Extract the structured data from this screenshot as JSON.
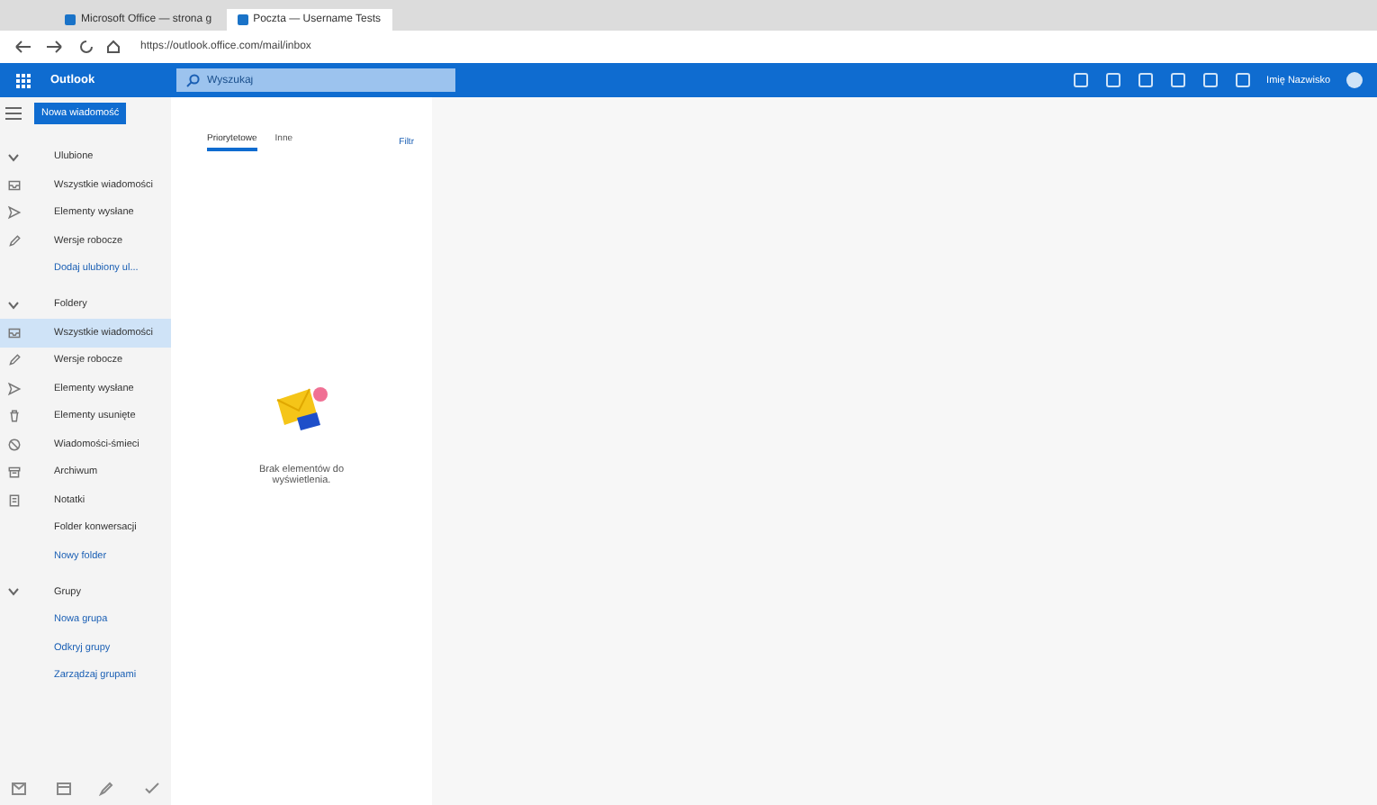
{
  "browser": {
    "tabs": [
      {
        "title": "Microsoft Office — strona g",
        "selected": false
      },
      {
        "title": "Poczta — Username Tests",
        "selected": true
      }
    ],
    "address": "https://outlook.office.com/mail/inbox"
  },
  "header": {
    "app_name": "Outlook",
    "search": {
      "placeholder": "Wyszukaj"
    },
    "user_name": "Imię Nazwisko"
  },
  "new_message_button": "Nowa wiadomość",
  "sections": [
    {
      "title": "Ulubione",
      "expanded": true,
      "items": [
        {
          "label": "Wszystkie wiadomości",
          "kind": "inbox",
          "selected": false
        },
        {
          "label": "Elementy wysłane",
          "kind": "send",
          "selected": false
        },
        {
          "label": "Wersje robocze",
          "kind": "pencil",
          "selected": false
        },
        {
          "label": "Dodaj ulubiony ul...",
          "kind": "link",
          "selected": false
        }
      ]
    },
    {
      "title": "Foldery",
      "expanded": true,
      "items": [
        {
          "label": "Wszystkie wiadomości",
          "kind": "inbox",
          "selected": true
        },
        {
          "label": "Wersje robocze",
          "kind": "pencil",
          "selected": false
        },
        {
          "label": "Elementy wysłane",
          "kind": "send",
          "selected": false
        },
        {
          "label": "Elementy usunięte",
          "kind": "trash",
          "selected": false
        },
        {
          "label": "Wiadomości-śmieci",
          "kind": "block",
          "selected": false
        },
        {
          "label": "Archiwum",
          "kind": "archive",
          "selected": false
        },
        {
          "label": "Notatki",
          "kind": "note",
          "selected": false
        },
        {
          "label": "Folder konwersacji",
          "kind": "plain",
          "selected": false
        },
        {
          "label": "Nowy folder",
          "kind": "link",
          "selected": false
        }
      ]
    },
    {
      "title": "Grupy",
      "expanded": true,
      "items": [
        {
          "label": "Nowa grupa",
          "kind": "link",
          "selected": false
        },
        {
          "label": "Odkryj grupy",
          "kind": "link",
          "selected": false
        },
        {
          "label": "Zarządzaj grupami",
          "kind": "link",
          "selected": false
        }
      ]
    }
  ],
  "list_tabs": [
    {
      "label": "Priorytetowe",
      "selected": true
    },
    {
      "label": "Inne",
      "selected": false
    }
  ],
  "filter": "Filtr",
  "empty_message": "Brak elementów do wyświetlenia."
}
